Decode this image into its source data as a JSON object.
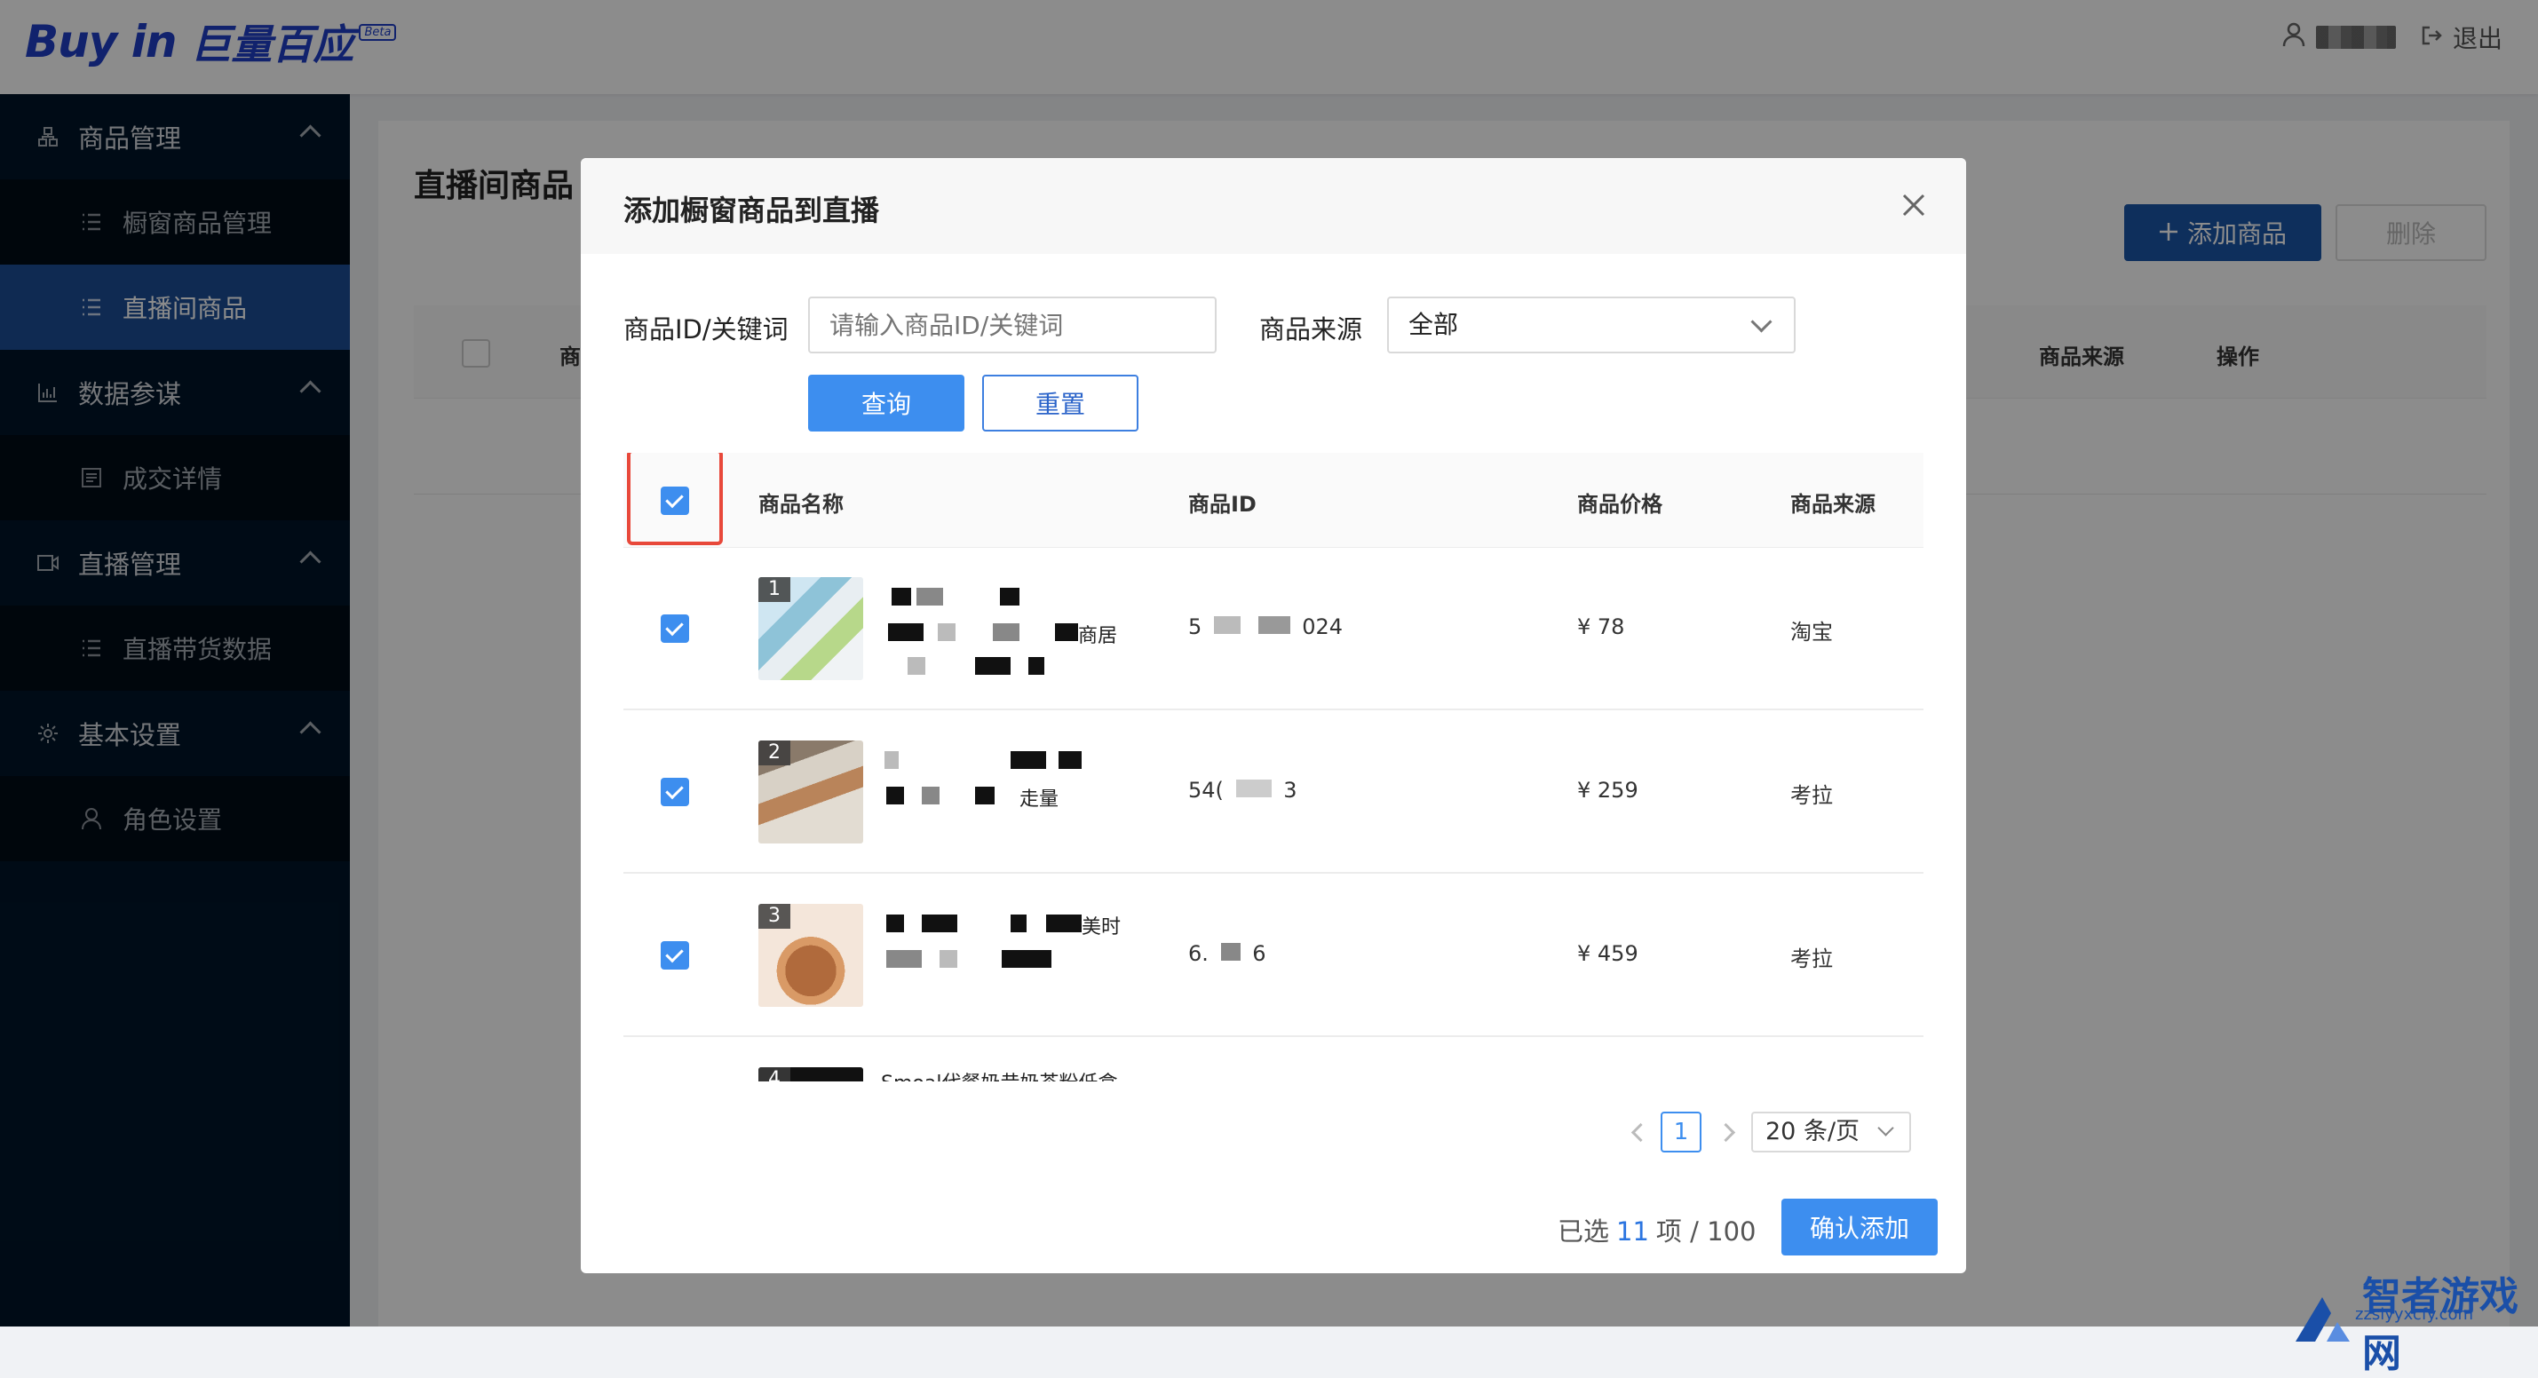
{
  "header": {
    "logo_main": "Buy in",
    "logo_cn": "巨量百应",
    "logo_badge": "Beta",
    "logout": "退出"
  },
  "sidebar": {
    "groups": [
      {
        "label": "商品管理",
        "icon": "product-icon",
        "items": [
          {
            "label": "橱窗商品管理",
            "active": false
          },
          {
            "label": "直播间商品",
            "active": true
          }
        ]
      },
      {
        "label": "数据参谋",
        "icon": "chart-icon",
        "items": [
          {
            "label": "成交详情",
            "active": false
          }
        ]
      },
      {
        "label": "直播管理",
        "icon": "video-icon",
        "items": [
          {
            "label": "直播带货数据",
            "active": false
          }
        ]
      },
      {
        "label": "基本设置",
        "icon": "gear-icon",
        "items": [
          {
            "label": "角色设置",
            "active": false
          }
        ]
      }
    ]
  },
  "page": {
    "title": "直播间商品",
    "add_button": "添加商品",
    "delete_button": "删除",
    "columns": [
      "商品",
      "商品来源",
      "操作"
    ]
  },
  "modal": {
    "title": "添加橱窗商品到直播",
    "filter": {
      "keyword_label": "商品ID/关键词",
      "keyword_placeholder": "请输入商品ID/关键词",
      "source_label": "商品来源",
      "source_value": "全部",
      "query_button": "查询",
      "reset_button": "重置"
    },
    "table": {
      "columns": [
        "商品名称",
        "商品ID",
        "商品价格",
        "商品来源"
      ],
      "rows": [
        {
          "index": "1",
          "name_tail": "商居",
          "id_head": "5",
          "id_tail": "024",
          "price": "¥ 78",
          "source": "淘宝"
        },
        {
          "index": "2",
          "name_tail": "走量",
          "id_head": "54(",
          "id_tail": "3",
          "price": "¥ 259",
          "source": "考拉"
        },
        {
          "index": "3",
          "name_tail": "美时",
          "id_head": "6.",
          "id_tail": "6",
          "price": "¥ 459",
          "source": "考拉"
        },
        {
          "index": "4",
          "name_tail": "Smoal代餐奶昔奶茶粉低盒",
          "id_head": "",
          "id_tail": "",
          "price": "",
          "source": ""
        }
      ]
    },
    "pager": {
      "current": "1",
      "page_size": "20 条/页"
    },
    "selected": {
      "prefix": "已选",
      "count": "11",
      "unit": "项",
      "total": "/ 100"
    },
    "confirm_button": "确认添加"
  },
  "watermark": {
    "title": "智者游戏网",
    "url": "zzslyyxcfy.com"
  }
}
